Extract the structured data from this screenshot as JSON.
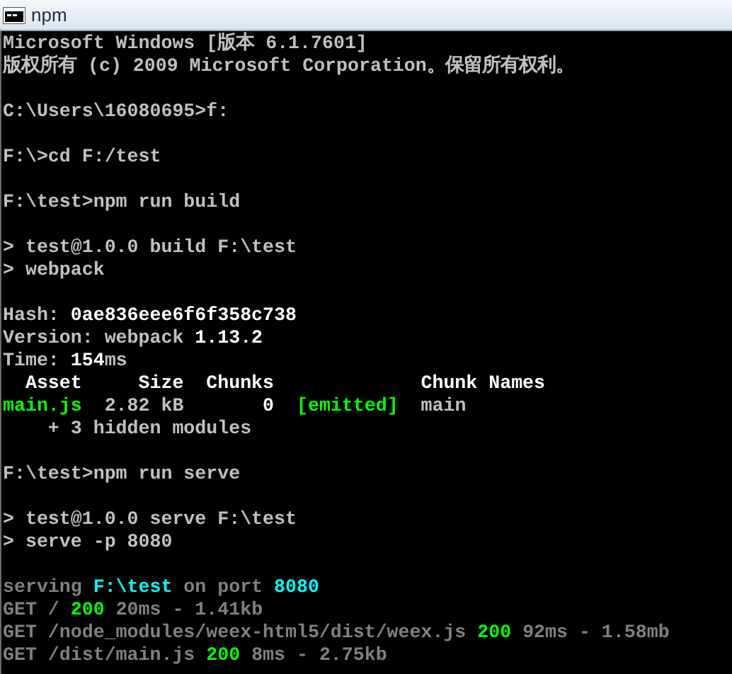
{
  "window": {
    "title": "npm"
  },
  "console": {
    "lines": [
      {
        "kind": "text",
        "segments": [
          {
            "text": "Microsoft Windows [版本 6.1.7601]",
            "color": "#c0c0c0"
          }
        ]
      },
      {
        "kind": "text",
        "segments": [
          {
            "text": "版权所有 (c) 2009 Microsoft Corporation。保留所有权利。",
            "color": "#c0c0c0"
          }
        ]
      },
      {
        "kind": "blank"
      },
      {
        "kind": "text",
        "segments": [
          {
            "text": "C:\\Users\\16080695>f:",
            "color": "#c0c0c0"
          }
        ]
      },
      {
        "kind": "blank"
      },
      {
        "kind": "text",
        "segments": [
          {
            "text": "F:\\>cd F:/test",
            "color": "#c0c0c0"
          }
        ]
      },
      {
        "kind": "blank"
      },
      {
        "kind": "text",
        "segments": [
          {
            "text": "F:\\test>npm run build",
            "color": "#c0c0c0"
          }
        ]
      },
      {
        "kind": "blank"
      },
      {
        "kind": "text",
        "segments": [
          {
            "text": "> test@1.0.0 build F:\\test",
            "color": "#c0c0c0"
          }
        ]
      },
      {
        "kind": "text",
        "segments": [
          {
            "text": "> webpack",
            "color": "#c0c0c0"
          }
        ]
      },
      {
        "kind": "blank"
      },
      {
        "kind": "text",
        "segments": [
          {
            "text": "Hash: ",
            "color": "#c0c0c0"
          },
          {
            "text": "0ae836eee6f6f358c738",
            "color": "#ffffff"
          }
        ]
      },
      {
        "kind": "text",
        "segments": [
          {
            "text": "Version: webpack ",
            "color": "#c0c0c0"
          },
          {
            "text": "1.13.2",
            "color": "#ffffff"
          }
        ]
      },
      {
        "kind": "text",
        "segments": [
          {
            "text": "Time: ",
            "color": "#c0c0c0"
          },
          {
            "text": "154",
            "color": "#ffffff"
          },
          {
            "text": "ms",
            "color": "#c0c0c0"
          }
        ]
      },
      {
        "kind": "text",
        "segments": [
          {
            "text": "  Asset     Size  Chunks             Chunk Names",
            "color": "#ffffff"
          }
        ]
      },
      {
        "kind": "text",
        "segments": [
          {
            "text": "main.js",
            "color": "#00ff00"
          },
          {
            "text": "  2.82 kB       ",
            "color": "#c0c0c0"
          },
          {
            "text": "0  ",
            "color": "#ffffff"
          },
          {
            "text": "[emitted]",
            "color": "#00ff00"
          },
          {
            "text": "  main",
            "color": "#c0c0c0"
          }
        ]
      },
      {
        "kind": "text",
        "segments": [
          {
            "text": "    + 3 hidden modules",
            "color": "#c0c0c0"
          }
        ]
      },
      {
        "kind": "blank"
      },
      {
        "kind": "text",
        "segments": [
          {
            "text": "F:\\test>npm run serve",
            "color": "#c0c0c0"
          }
        ]
      },
      {
        "kind": "blank"
      },
      {
        "kind": "text",
        "segments": [
          {
            "text": "> test@1.0.0 serve F:\\test",
            "color": "#c0c0c0"
          }
        ]
      },
      {
        "kind": "text",
        "segments": [
          {
            "text": "> serve -p 8080",
            "color": "#c0c0c0"
          }
        ]
      },
      {
        "kind": "blank"
      },
      {
        "kind": "text",
        "segments": [
          {
            "text": "serving ",
            "color": "#808080"
          },
          {
            "text": "F:\\test",
            "color": "#00ffff"
          },
          {
            "text": " on port ",
            "color": "#808080"
          },
          {
            "text": "8080",
            "color": "#00ffff"
          }
        ]
      },
      {
        "kind": "text",
        "segments": [
          {
            "text": "GET / ",
            "color": "#808080"
          },
          {
            "text": "200",
            "color": "#00ff00"
          },
          {
            "text": " 20ms - 1.41kb",
            "color": "#808080"
          }
        ]
      },
      {
        "kind": "text",
        "segments": [
          {
            "text": "GET /node_modules/weex-html5/dist/weex.js ",
            "color": "#808080"
          },
          {
            "text": "200",
            "color": "#00ff00"
          },
          {
            "text": " 92ms - 1.58mb",
            "color": "#808080"
          }
        ]
      },
      {
        "kind": "text",
        "segments": [
          {
            "text": "GET /dist/main.js ",
            "color": "#808080"
          },
          {
            "text": "200",
            "color": "#00ff00"
          },
          {
            "text": " 8ms - 2.75kb",
            "color": "#808080"
          }
        ]
      }
    ]
  }
}
